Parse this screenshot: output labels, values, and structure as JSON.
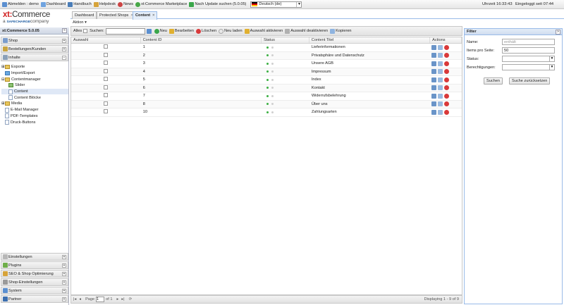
{
  "topbar": {
    "items": [
      "Abmelden : demo",
      "Dashboard",
      "Handbuch",
      "Helpdesk",
      "News",
      "xt:Commerce Marketplace",
      "Nach Update suchen (5.0.05)"
    ],
    "language": "Deutsch (de)",
    "time": "Uhrzeit 16:33:43",
    "logged_in": "Eingeloggt seit 07:44"
  },
  "logo": {
    "brand_red": "xt:",
    "brand_rest": "Commerce",
    "sub_a": "a",
    "sub_sc": "SAFECHARGE",
    "sub_company": "company"
  },
  "left": {
    "version": "xt:Commerce 5.0.05",
    "top_sections": [
      "Shop",
      "Bestellungen/Kunden",
      "Inhalte"
    ],
    "tree": [
      "Exporte",
      "Import/Export",
      "Contentmanager",
      "Slider",
      "Content",
      "Content Blöcke",
      "Media",
      "E-Mail Manager",
      "PDF-Templates",
      "Druck-Buttons"
    ],
    "bottom_sections": [
      "Einstellungen",
      "Plugins",
      "SEO & Shop Optimierung",
      "Shop-Einstellungen",
      "System",
      "Partner"
    ]
  },
  "tabs": [
    {
      "label": "Dashboard"
    },
    {
      "label": "Protected Shops",
      "close": "×"
    },
    {
      "label": "Content",
      "close": "×"
    }
  ],
  "menubar": {
    "aktion": "Aktion ▾"
  },
  "toolbar": {
    "alles": "Alles",
    "suchen": "Suchen:",
    "neu": "Neu",
    "bearbeiten": "Bearbeiten",
    "loeschen": "Löschen",
    "neu_laden": "Neu laden",
    "aktivieren": "Auswahl aktivieren",
    "deaktivieren": "Auswahl deaktivieren",
    "kopieren": "Kopieren"
  },
  "grid": {
    "headers": [
      "Auswahl",
      "Content ID",
      "Status",
      "Content Titel",
      "Actions"
    ],
    "rows": [
      {
        "id": "1",
        "title": "Lieferinformationen"
      },
      {
        "id": "2",
        "title": "Privatsphäre und Datenschutz"
      },
      {
        "id": "3",
        "title": "Unsere AGB"
      },
      {
        "id": "4",
        "title": "Impressum"
      },
      {
        "id": "5",
        "title": "Index"
      },
      {
        "id": "6",
        "title": "Kontakt"
      },
      {
        "id": "7",
        "title": "Widerrufsbelehrung"
      },
      {
        "id": "8",
        "title": "Über uns"
      },
      {
        "id": "10",
        "title": "Zahlungsarten"
      }
    ]
  },
  "pager": {
    "page": "Page",
    "page_value": "1",
    "of": "of 1",
    "display": "Displaying 1 - 9 of 9"
  },
  "filter": {
    "title": "Filter",
    "name_label": "Name:",
    "name_placeholder": "enthält",
    "items_label": "Items pro Seite:",
    "items_value": "50",
    "status_label": "Status:",
    "rights_label": "Berechtigungen:",
    "search_btn": "Suchen",
    "reset_btn": "Suche zurücksetzen"
  },
  "colors": {
    "accent": "#99bbe8",
    "status_green": "#3cb043",
    "delete_red": "#d9393a",
    "brand_red": "#d02020"
  }
}
